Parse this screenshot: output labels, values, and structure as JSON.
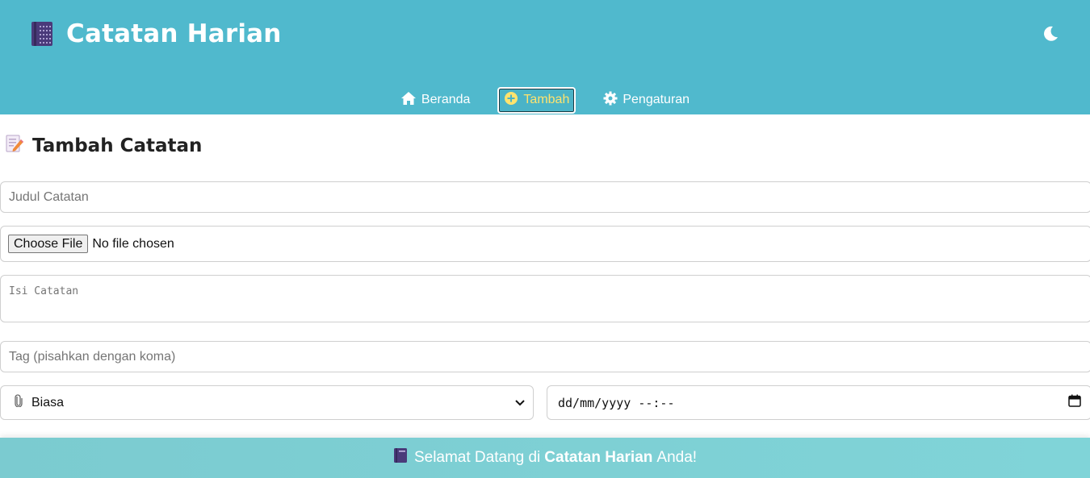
{
  "header": {
    "title": "Catatan Harian",
    "logo_icon": "notebook-icon",
    "theme_toggle_icon": "moon-icon"
  },
  "nav": {
    "items": [
      {
        "label": "Beranda",
        "icon": "home-icon",
        "active": false
      },
      {
        "label": "Tambah",
        "icon": "plus-circle-icon",
        "active": true
      },
      {
        "label": "Pengaturan",
        "icon": "gear-icon",
        "active": false
      }
    ]
  },
  "form": {
    "heading": "Tambah Catatan",
    "heading_icon": "memo-icon",
    "title_placeholder": "Judul Catatan",
    "title_value": "",
    "file_button_label": "Choose File",
    "file_status": "No file chosen",
    "content_placeholder": "Isi Catatan",
    "content_value": "",
    "tags_placeholder": "Tag (pisahkan dengan koma)",
    "tags_value": "",
    "priority_selected": "Biasa",
    "priority_icon": "paperclip-icon",
    "datetime_value": "dd/mm/yyyy --:--"
  },
  "footer": {
    "prefix": "Selamat Datang di",
    "brand": "Catatan Harian",
    "suffix": "Anda!"
  },
  "colors": {
    "header_bg": "#50b9cd",
    "active_nav": "#ffe36e",
    "footer_bg": "#7bcbd0"
  }
}
